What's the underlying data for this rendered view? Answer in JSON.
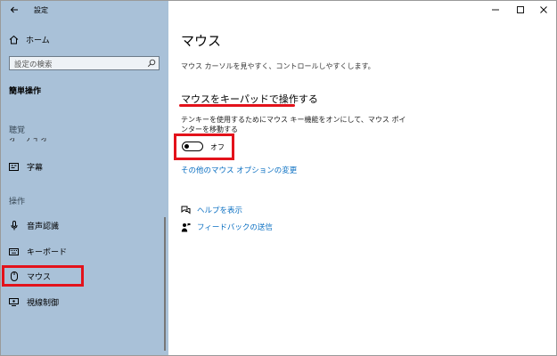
{
  "window": {
    "title": "設定",
    "minimize_icon": "minimize-icon",
    "maximize_icon": "maximize-icon",
    "close_icon": "close-icon"
  },
  "sidebar": {
    "home_label": "ホーム",
    "search_placeholder": "設定の検索",
    "section_title": "簡単操作",
    "group_hearing": "聴覚",
    "clipped_item": "オーディオ",
    "caption_label": "字幕",
    "group_interaction": "操作",
    "items": [
      {
        "label": "音声認識",
        "icon": "microphone-icon"
      },
      {
        "label": "キーボード",
        "icon": "keyboard-icon"
      },
      {
        "label": "マウス",
        "icon": "mouse-icon",
        "selected": true
      },
      {
        "label": "視線制御",
        "icon": "eye-control-icon"
      }
    ]
  },
  "main": {
    "title": "マウス",
    "description": "マウス カーソルを見やすく、コントロールしやすくします。",
    "keys_heading": "マウスをキーパッドで操作する",
    "keys_description": "テンキーを使用するためにマウス キー機能をオンにして、マウス ポインターを移動する",
    "toggle_state": "オフ",
    "toggle_on": false,
    "other_options_link": "その他のマウス オプションの変更",
    "help_link": "ヘルプを表示",
    "feedback_link": "フィードバックの送信"
  },
  "colors": {
    "sidebar_bg": "#a9c1d8",
    "link": "#0a6fc2",
    "highlight": "#e3121b"
  }
}
